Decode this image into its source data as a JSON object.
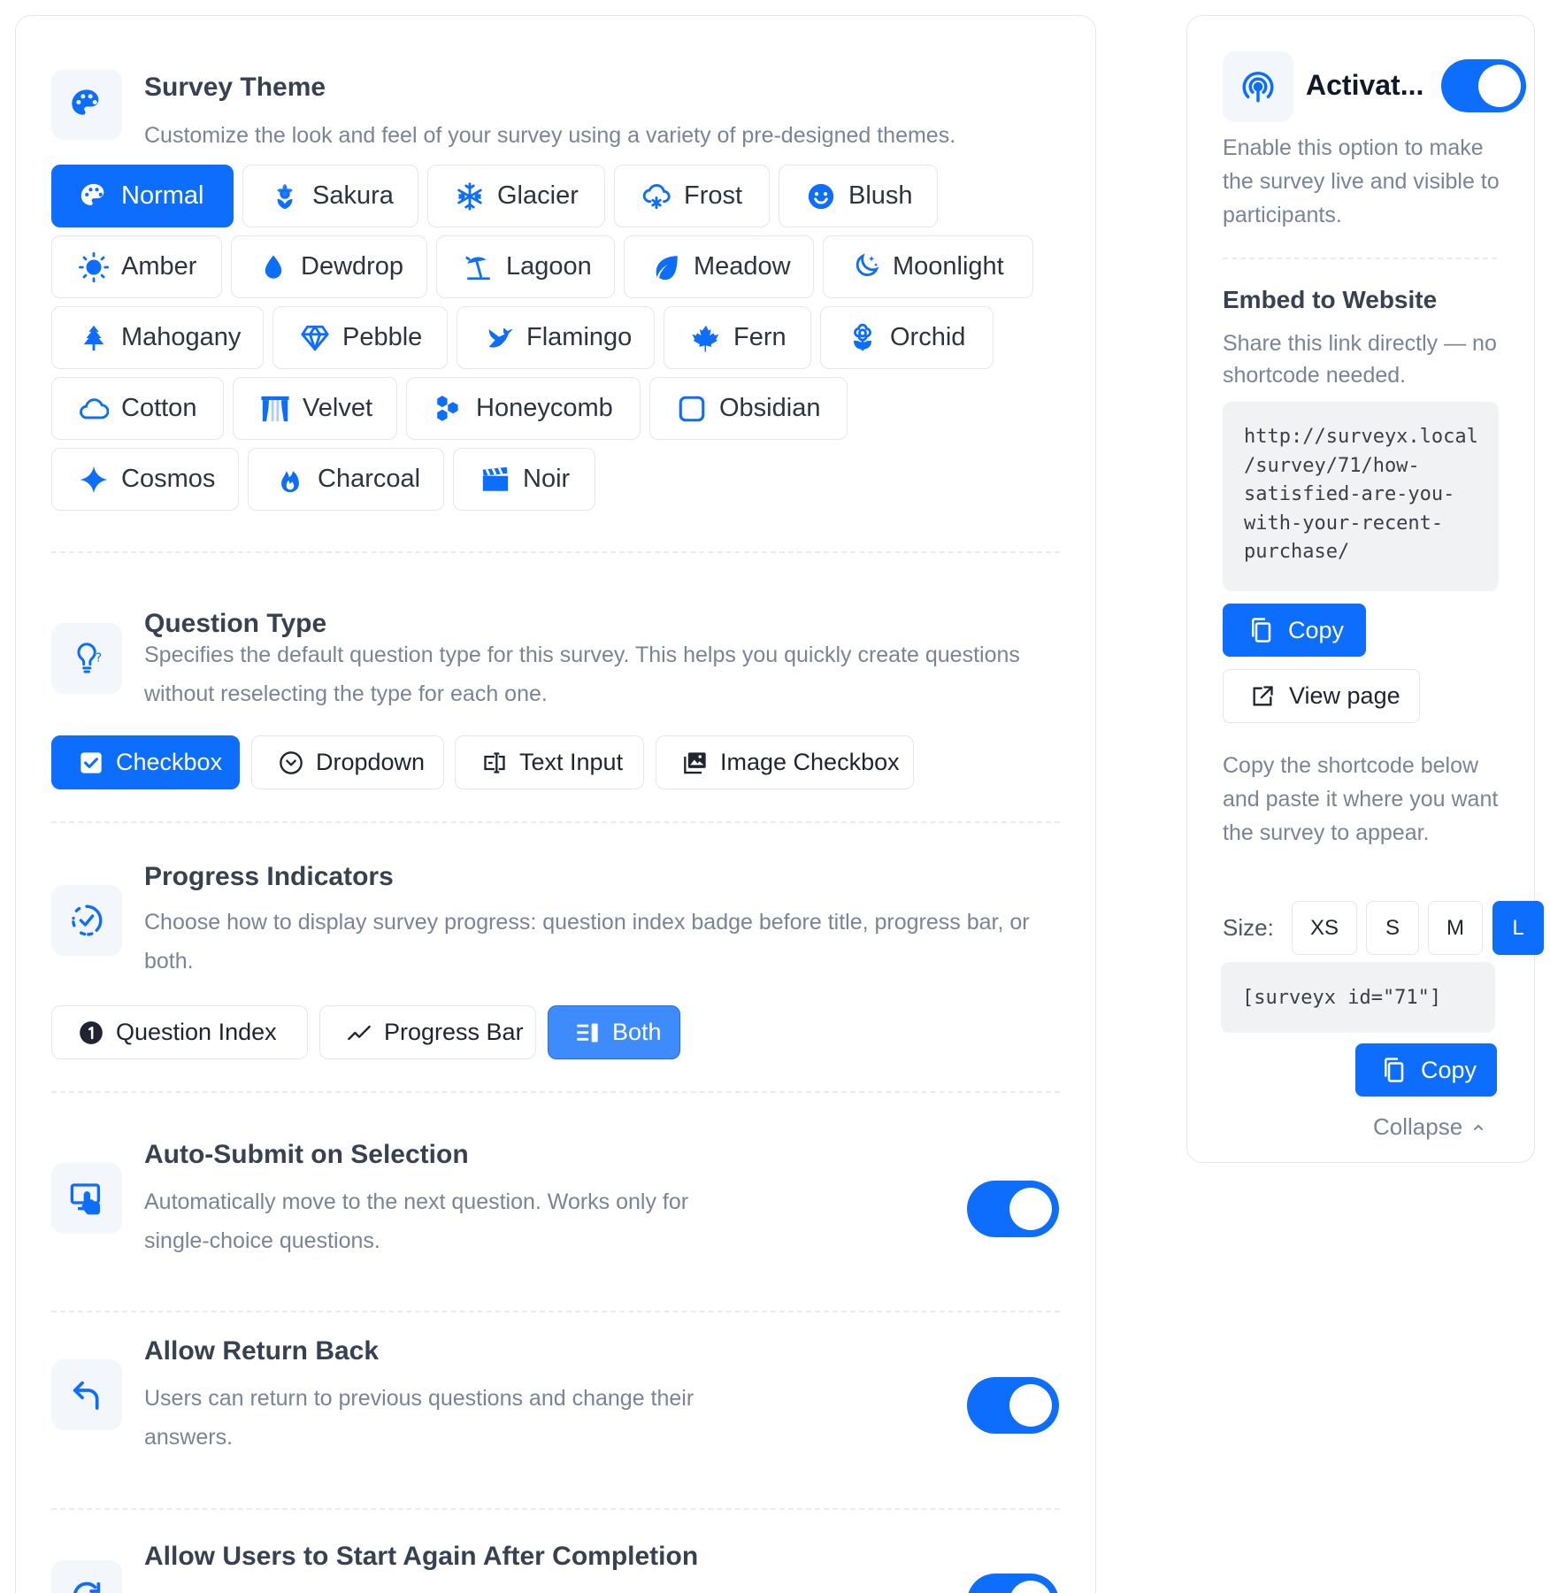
{
  "accent_color": "#0d6efd",
  "survey_theme": {
    "title": "Survey Theme",
    "description": "Customize the look and feel of your survey using a variety of pre-designed themes.",
    "icon": "palette-icon",
    "selected": "Normal",
    "themes": [
      {
        "label": "Normal",
        "icon": "palette-icon"
      },
      {
        "label": "Sakura",
        "icon": "flower-icon"
      },
      {
        "label": "Glacier",
        "icon": "snowflake-icon"
      },
      {
        "label": "Frost",
        "icon": "cloud-snow-icon"
      },
      {
        "label": "Blush",
        "icon": "smile-icon"
      },
      {
        "label": "Amber",
        "icon": "sun-icon"
      },
      {
        "label": "Dewdrop",
        "icon": "droplet-icon"
      },
      {
        "label": "Lagoon",
        "icon": "beach-umbrella-icon"
      },
      {
        "label": "Meadow",
        "icon": "leaf-icon"
      },
      {
        "label": "Moonlight",
        "icon": "moon-stars-icon"
      },
      {
        "label": "Mahogany",
        "icon": "tree-icon"
      },
      {
        "label": "Pebble",
        "icon": "gem-icon"
      },
      {
        "label": "Flamingo",
        "icon": "bird-icon"
      },
      {
        "label": "Fern",
        "icon": "maple-leaf-icon"
      },
      {
        "label": "Orchid",
        "icon": "flower-alt-icon"
      },
      {
        "label": "Cotton",
        "icon": "cloud-icon"
      },
      {
        "label": "Velvet",
        "icon": "curtains-icon"
      },
      {
        "label": "Honeycomb",
        "icon": "hexagons-icon"
      },
      {
        "label": "Obsidian",
        "icon": "square-icon"
      },
      {
        "label": "Cosmos",
        "icon": "sparkle-icon"
      },
      {
        "label": "Charcoal",
        "icon": "fire-icon"
      },
      {
        "label": "Noir",
        "icon": "film-clapper-icon"
      }
    ]
  },
  "question_type": {
    "title": "Question Type",
    "description": "Specifies the default question type for this survey. This helps you quickly create questions without reselecting the type for each one.",
    "icon": "lightbulb-question-icon",
    "selected": "Checkbox",
    "options": [
      {
        "label": "Checkbox",
        "icon": "checkbox-icon"
      },
      {
        "label": "Dropdown",
        "icon": "dropdown-circle-icon"
      },
      {
        "label": "Text Input",
        "icon": "text-input-icon"
      },
      {
        "label": "Image Checkbox",
        "icon": "images-icon"
      }
    ]
  },
  "progress_indicators": {
    "title": "Progress Indicators",
    "description": "Choose how to display survey progress: question index badge before title, progress bar, or both.",
    "icon": "progress-circle-check-icon",
    "selected": "Both",
    "options": [
      {
        "label": "Question Index",
        "icon": "number-one-circle-icon"
      },
      {
        "label": "Progress Bar",
        "icon": "trend-line-icon"
      },
      {
        "label": "Both",
        "icon": "both-layout-icon"
      }
    ]
  },
  "auto_submit": {
    "title": "Auto-Submit on Selection",
    "description": "Automatically move to the next question. Works only for single-choice questions.",
    "icon": "touch-screen-icon",
    "enabled": true
  },
  "allow_return": {
    "title": "Allow Return Back",
    "description": "Users can return to previous questions and change their answers.",
    "icon": "return-arrow-icon",
    "enabled": true
  },
  "start_again": {
    "title": "Allow Users to Start Again After Completion",
    "icon": "restart-arrow-icon",
    "enabled": true
  },
  "sidebar": {
    "activate_title": "Activat...",
    "activate_description": "Enable this option to make the survey live and visible to participants.",
    "activate_enabled": true,
    "activate_icon": "broadcast-icon",
    "embed_title": "Embed to Website",
    "embed_description": "Share this link directly — no shortcode needed.",
    "link_lines": [
      "http://surveyx.local",
      "/survey/71/how-",
      "satisfied-are-you-",
      "with-your-recent-",
      "purchase/"
    ],
    "copy_label": "Copy",
    "view_page_label": "View page",
    "shortcode_description": "Copy the shortcode below and paste it where you want the survey to appear.",
    "size_label": "Size:",
    "sizes": [
      "XS",
      "S",
      "M",
      "L"
    ],
    "selected_size": "L",
    "shortcode": "[surveyx id=\"71\"]",
    "copy_label_2": "Copy",
    "collapse_label": "Collapse"
  }
}
